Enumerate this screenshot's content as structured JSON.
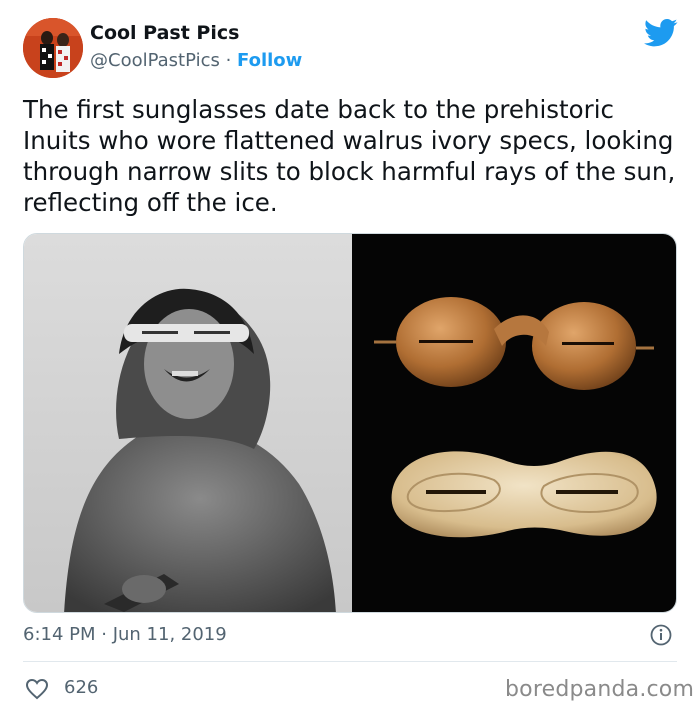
{
  "author": {
    "display_name": "Cool Past Pics",
    "handle": "@CoolPastPics",
    "separator": " · ",
    "follow_label": "Follow"
  },
  "tweet": {
    "text": "The first sunglasses date back to the prehistoric Inuits who wore flattened walrus ivory specs, looking through narrow slits to block harmful rays of the sun, reflecting off the ice.",
    "timestamp": "6:14 PM · Jun 11, 2019",
    "like_count": "626"
  },
  "icons": {
    "brand": "twitter-bird-icon",
    "info": "info-icon",
    "like": "heart-icon"
  },
  "watermark": "boredpanda.com",
  "colors": {
    "accent": "#1d9bf0",
    "secondary_text": "#536471"
  }
}
